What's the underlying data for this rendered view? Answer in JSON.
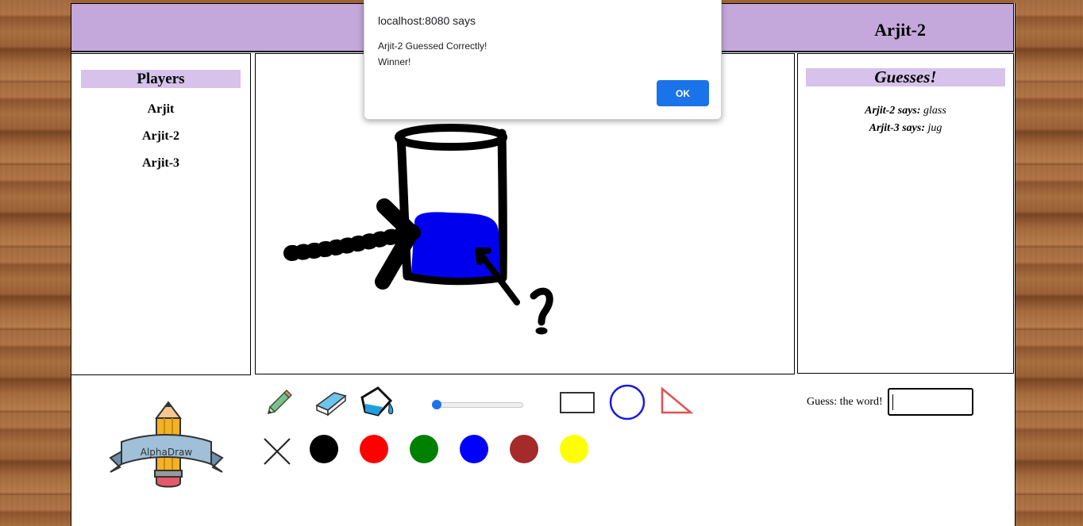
{
  "dialog": {
    "title": "localhost:8080 says",
    "line1": "Arjit-2 Guessed Correctly!",
    "line2": "Winner!",
    "ok_label": "OK"
  },
  "header": {
    "current_player": "Arjit-2"
  },
  "players": {
    "title": "Players",
    "items": [
      {
        "label": "Arjit"
      },
      {
        "label": "Arjit-2"
      },
      {
        "label": "Arjit-3"
      }
    ]
  },
  "guesses": {
    "title": "Guesses!",
    "items": [
      {
        "who": "Arjit-2 says:",
        "word": "glass"
      },
      {
        "who": "Arjit-3 says:",
        "word": "jug"
      }
    ]
  },
  "toolbar": {
    "logo_text": "AlphaDraw",
    "tools": [
      "pencil-icon",
      "eraser-icon",
      "paint-bucket-icon",
      "rectangle-tool-icon",
      "circle-tool-icon",
      "triangle-tool-icon",
      "clear-icon"
    ],
    "brush_size": 0,
    "colors": [
      "#000000",
      "#ff0000",
      "#008000",
      "#0000ff",
      "#a52a2a",
      "#ffff00"
    ],
    "guess_label": "Guess: the word!",
    "guess_value": ""
  }
}
